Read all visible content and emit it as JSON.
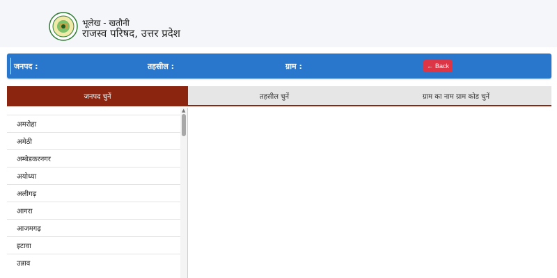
{
  "header": {
    "line1": "भूलेख - खतौनी",
    "line2": "राजस्व परिषद, उत्तर प्रदेश",
    "logo_icon": "emblem-seal-icon"
  },
  "info_bar": {
    "district_label": "जनपद :",
    "tehsil_label": "तहसील :",
    "village_label": "ग्राम :",
    "back_label": "Back",
    "back_icon": "arrow-left-icon",
    "bar_color": "#2877cc",
    "back_color": "#dc3545"
  },
  "tabs": [
    {
      "label": "जनपद चुनें",
      "active": true
    },
    {
      "label": "तहसील चुनें",
      "active": false
    },
    {
      "label": "ग्राम का नाम ग्राम कोड चुनें",
      "active": false
    }
  ],
  "tab_active_color": "#8b2510",
  "districts": [
    "अमरोहा",
    "अमेठी",
    "अम्बेडकरनगर",
    "अयोध्या",
    "अलीगढ़",
    "आगरा",
    "आजमगढ़",
    "इटावा",
    "उन्नाव"
  ]
}
